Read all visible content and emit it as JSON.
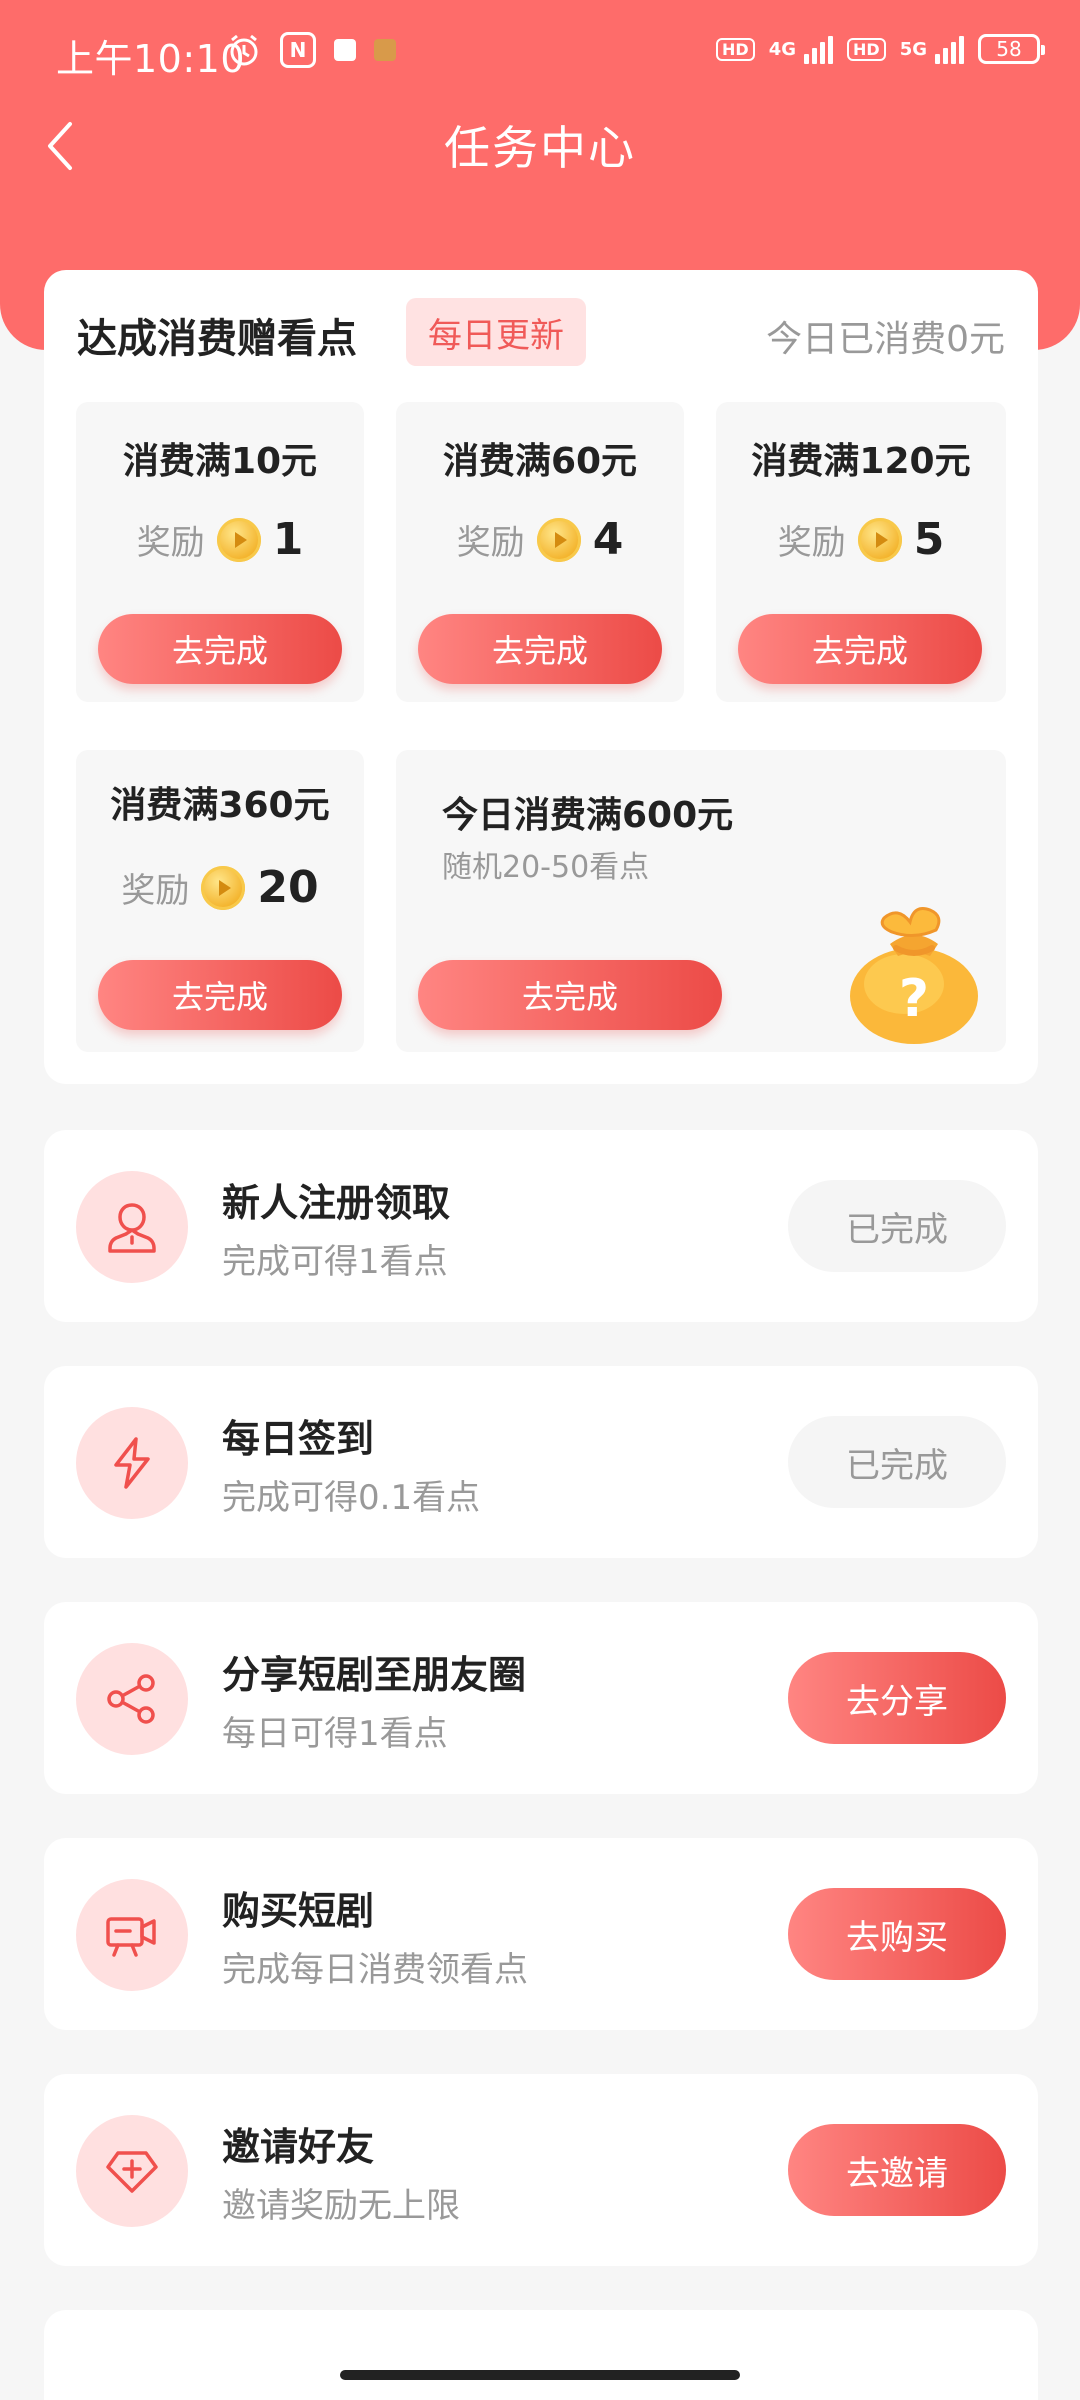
{
  "status_bar": {
    "time": "上午10:10",
    "net1": "4G",
    "net2": "5G",
    "hd_label": "HD",
    "battery": "58"
  },
  "nav": {
    "title": "任务中心"
  },
  "consume": {
    "title": "达成消费赠看点",
    "badge": "每日更新",
    "today_spent": "今日已消费0元",
    "reward_label": "奖励",
    "tiers": [
      {
        "title": "消费满10元",
        "reward": "1",
        "button": "去完成"
      },
      {
        "title": "消费满60元",
        "reward": "4",
        "button": "去完成"
      },
      {
        "title": "消费满120元",
        "reward": "5",
        "button": "去完成"
      },
      {
        "title": "消费满360元",
        "reward": "20",
        "button": "去完成"
      }
    ],
    "big_tier": {
      "title": "今日消费满600元",
      "subtitle": "随机20-50看点",
      "button": "去完成",
      "icon": "mystery-bag-icon"
    }
  },
  "tasks": [
    {
      "title": "新人注册领取",
      "subtitle": "完成可得1看点",
      "button": "已完成",
      "state": "done",
      "icon": "user-icon"
    },
    {
      "title": "每日签到",
      "subtitle": "完成可得0.1看点",
      "button": "已完成",
      "state": "done",
      "icon": "lightning-icon"
    },
    {
      "title": "分享短剧至朋友圈",
      "subtitle": "每日可得1看点",
      "button": "去分享",
      "state": "active",
      "icon": "share-icon"
    },
    {
      "title": "购买短剧",
      "subtitle": "完成每日消费领看点",
      "button": "去购买",
      "state": "active",
      "icon": "video-camera-icon"
    },
    {
      "title": "邀请好友",
      "subtitle": "邀请奖励无上限",
      "button": "去邀请",
      "state": "active",
      "icon": "diamond-plus-icon"
    }
  ],
  "colors": {
    "primary": "#fe6c6a",
    "accent_start": "#ff8582",
    "accent_end": "#ec4b47",
    "icon_bg": "#ffe0e0"
  }
}
